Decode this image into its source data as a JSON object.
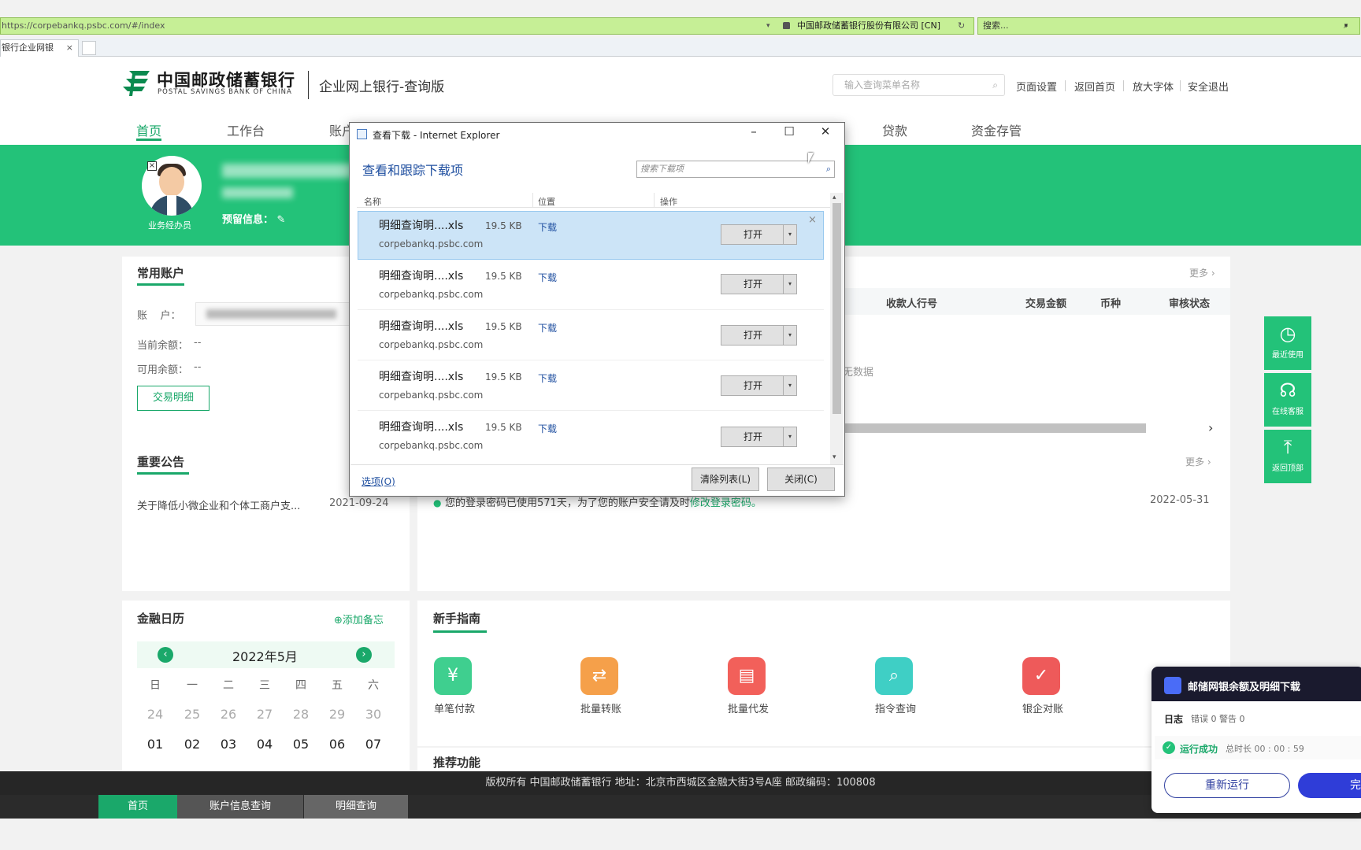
{
  "browser": {
    "url": "https://corpebankq.psbc.com/#/index",
    "cert": "中国邮政储蓄银行股份有限公司 [CN]",
    "search_placeholder": "搜索...",
    "tab_title": "银行企业网银",
    "tab_close": "×"
  },
  "header": {
    "bank_cn": "中国邮政储蓄银行",
    "bank_en": "POSTAL SAVINGS BANK OF CHINA",
    "site_name": "企业网上银行-查询版",
    "menu_search_placeholder": "输入查询菜单名称",
    "links": [
      "页面设置",
      "返回首页",
      "放大字体",
      "安全退出"
    ]
  },
  "nav": {
    "items": [
      "首页",
      "工作台",
      "账户",
      "贷款",
      "资金存管"
    ],
    "active": "首页"
  },
  "banner": {
    "role": "业务经办员",
    "reserve_info": "预留信息：",
    "edit_icon": "✎"
  },
  "accounts": {
    "title": "常用账户",
    "account_label": "账    户：",
    "balance_label": "当前余额：",
    "balance_value": "--",
    "available_label": "可用余额：",
    "available_value": "--",
    "detail_button": "交易明细"
  },
  "tasks": {
    "more": "更多 ›",
    "columns": [
      "收款人行号",
      "交易金额",
      "币种",
      "审核状态"
    ],
    "no_data": "无数据",
    "scroll_arrow": "›"
  },
  "notices": {
    "title": "重要公告",
    "more": "更多 ›",
    "items": [
      {
        "text": "关于降低小微企业和个体工商户支...",
        "date": "2021-09-24"
      }
    ]
  },
  "messages": {
    "text": "您的登录密码已使用571天，为了您的账户安全请及时",
    "link": "修改登录密码。",
    "date": "2022-05-31"
  },
  "side_tools": [
    {
      "label": "最近使用",
      "icon": "clock-icon",
      "glyph": "◷"
    },
    {
      "label": "在线客服",
      "icon": "headset-icon",
      "glyph": "☊"
    },
    {
      "label": "返回顶部",
      "icon": "arrow-up-icon",
      "glyph": "⤒"
    }
  ],
  "calendar": {
    "title": "金融日历",
    "add_memo": "⊕添加备忘",
    "month": "2022年5月",
    "prev": "‹",
    "next": "›",
    "weekdays": [
      "日",
      "一",
      "二",
      "三",
      "四",
      "五",
      "六"
    ],
    "prev_week": [
      "24",
      "25",
      "26",
      "27",
      "28",
      "29",
      "30"
    ],
    "week1": [
      "01",
      "02",
      "03",
      "04",
      "05",
      "06",
      "07"
    ]
  },
  "guide": {
    "title": "新手指南",
    "items": [
      {
        "label": "单笔付款",
        "color": "#3fcf8f",
        "glyph": "¥"
      },
      {
        "label": "批量转账",
        "color": "#f5a04a",
        "glyph": "⇄"
      },
      {
        "label": "批量代发",
        "color": "#f2605a",
        "glyph": "▤"
      },
      {
        "label": "指令查询",
        "color": "#3fcfc5",
        "glyph": "⌕"
      },
      {
        "label": "银企对账",
        "color": "#ee5a5a",
        "glyph": "✓"
      }
    ]
  },
  "recommend": {
    "title": "推荐功能"
  },
  "footer": {
    "text": "版权所有 中国邮政储蓄银行 地址：北京市西城区金融大街3号A座 邮政编码：100808"
  },
  "bottom_tabs": [
    "首页",
    "账户信息查询",
    "明细查询"
  ],
  "download_dialog": {
    "title": "查看下载 - Internet Explorer",
    "heading": "查看和跟踪下载项",
    "search_placeholder": "搜索下载项",
    "columns": [
      "名称",
      "位置",
      "操作"
    ],
    "items": [
      {
        "name": "明细查询明....xls",
        "size": "19.5 KB",
        "location": "下载",
        "domain": "corpebankq.psbc.com",
        "action": "打开",
        "selected": true
      },
      {
        "name": "明细查询明....xls",
        "size": "19.5 KB",
        "location": "下载",
        "domain": "corpebankq.psbc.com",
        "action": "打开",
        "selected": false
      },
      {
        "name": "明细查询明....xls",
        "size": "19.5 KB",
        "location": "下载",
        "domain": "corpebankq.psbc.com",
        "action": "打开",
        "selected": false
      },
      {
        "name": "明细查询明....xls",
        "size": "19.5 KB",
        "location": "下载",
        "domain": "corpebankq.psbc.com",
        "action": "打开",
        "selected": false
      },
      {
        "name": "明细查询明....xls",
        "size": "19.5 KB",
        "location": "下载",
        "domain": "corpebankq.psbc.com",
        "action": "打开",
        "selected": false
      }
    ],
    "options": "选项(O)",
    "clear": "清除列表(L)",
    "close": "关闭(C)"
  },
  "task_panel": {
    "title": "邮储网银余额及明细下载",
    "log_label": "日志",
    "counts": "错误 0  警告 0",
    "status": "运行成功",
    "duration": "总时长 00 : 00 : 59",
    "rerun": "重新运行",
    "done": "完"
  },
  "colors": {
    "brand_green": "#23c279",
    "accent_green": "#1aa86a",
    "ie_blue": "#1f4fa0"
  }
}
